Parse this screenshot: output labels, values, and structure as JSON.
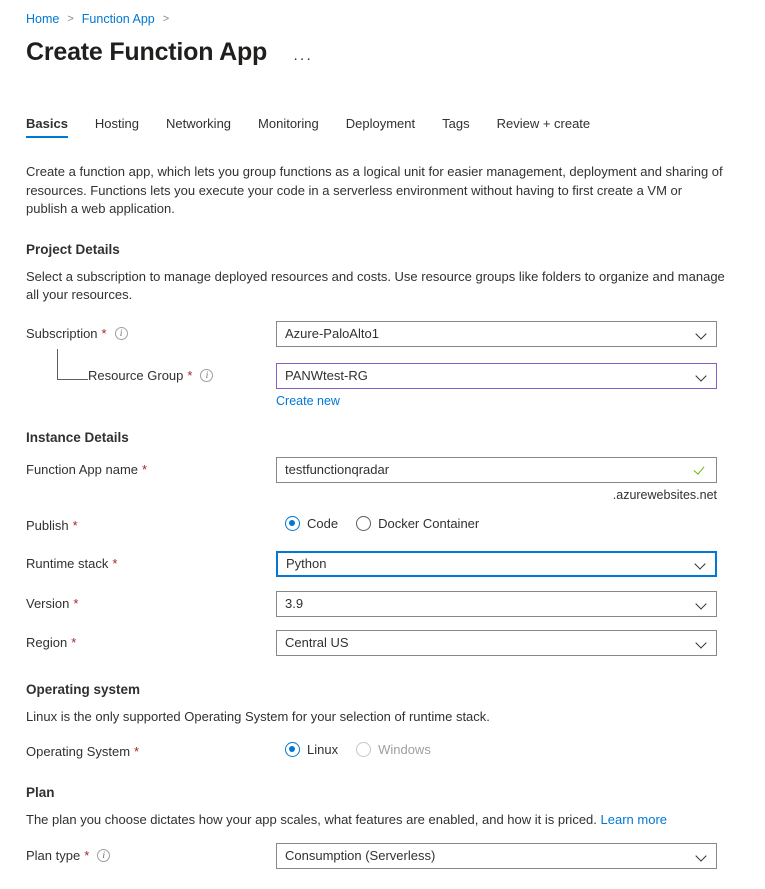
{
  "breadcrumb": {
    "items": [
      {
        "label": "Home"
      },
      {
        "label": "Function App"
      }
    ],
    "separator": ">"
  },
  "header": {
    "title": "Create Function App",
    "more_menu": "···"
  },
  "tabs": [
    {
      "label": "Basics",
      "active": true
    },
    {
      "label": "Hosting",
      "active": false
    },
    {
      "label": "Networking",
      "active": false
    },
    {
      "label": "Monitoring",
      "active": false
    },
    {
      "label": "Deployment",
      "active": false
    },
    {
      "label": "Tags",
      "active": false
    },
    {
      "label": "Review + create",
      "active": false
    }
  ],
  "intro": "Create a function app, which lets you group functions as a logical unit for easier management, deployment and sharing of resources. Functions lets you execute your code in a serverless environment without having to first create a VM or publish a web application.",
  "project_details": {
    "heading": "Project Details",
    "description": "Select a subscription to manage deployed resources and costs. Use resource groups like folders to organize and manage all your resources.",
    "subscription": {
      "label": "Subscription",
      "required": "*",
      "value": "Azure-PaloAlto1"
    },
    "resource_group": {
      "label": "Resource Group",
      "required": "*",
      "value": "PANWtest-RG",
      "create_new": "Create new"
    }
  },
  "instance_details": {
    "heading": "Instance Details",
    "function_app_name": {
      "label": "Function App name",
      "required": "*",
      "value": "testfunctionqradar",
      "placeholder": "",
      "suffix": ".azurewebsites.net",
      "validation": "valid"
    },
    "publish": {
      "label": "Publish",
      "required": "*",
      "selected": "Code",
      "options": [
        {
          "label": "Code",
          "checked": true,
          "disabled": false
        },
        {
          "label": "Docker Container",
          "checked": false,
          "disabled": false
        }
      ]
    },
    "runtime_stack": {
      "label": "Runtime stack",
      "required": "*",
      "value": "Python"
    },
    "version": {
      "label": "Version",
      "required": "*",
      "value": "3.9"
    },
    "region": {
      "label": "Region",
      "required": "*",
      "value": "Central US"
    }
  },
  "operating_system": {
    "heading": "Operating system",
    "description": "Linux is the only supported Operating System for your selection of runtime stack.",
    "field": {
      "label": "Operating System",
      "required": "*",
      "selected": "Linux",
      "options": [
        {
          "label": "Linux",
          "checked": true,
          "disabled": false
        },
        {
          "label": "Windows",
          "checked": false,
          "disabled": true
        }
      ]
    }
  },
  "plan": {
    "heading": "Plan",
    "description": "The plan you choose dictates how your app scales, what features are enabled, and how it is priced.",
    "learn_more": "Learn more",
    "plan_type": {
      "label": "Plan type",
      "required": "*",
      "value": "Consumption (Serverless)"
    }
  },
  "colors": {
    "accent": "#0078d4",
    "required_asterisk": "#a4262c",
    "visited_border": "#8661c5",
    "valid_check": "#6bb700",
    "text": "#323130"
  }
}
